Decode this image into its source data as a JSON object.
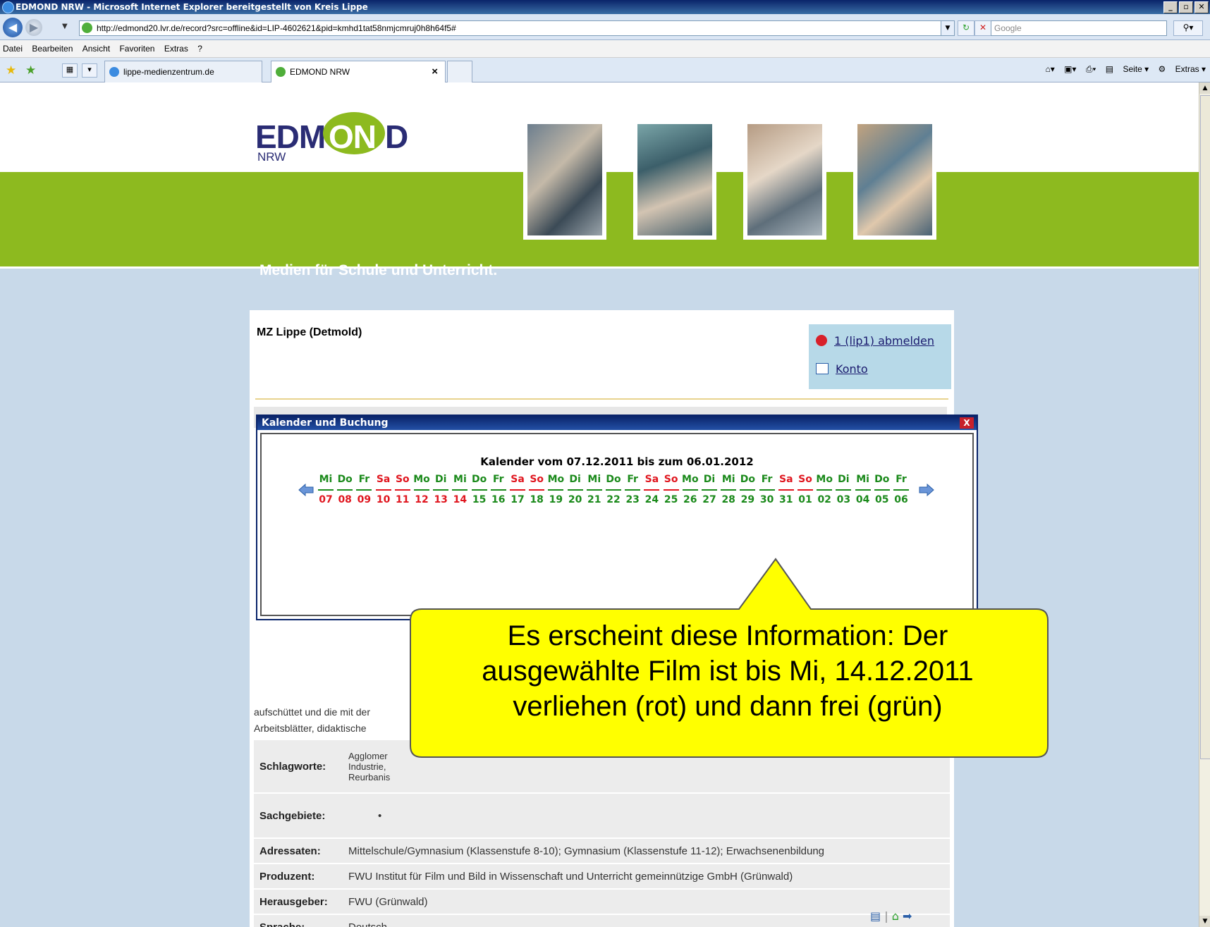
{
  "window": {
    "title": "EDMOND NRW - Microsoft Internet Explorer bereitgestellt von Kreis Lippe",
    "buttons": [
      "_",
      "̅",
      "X"
    ]
  },
  "addressbar": {
    "url": "http://edmond20.lvr.de/record?src=offline&id=LIP-4602621&pid=kmhd1tat58nmjcmruj0h8h64f5#",
    "search_placeholder": "Google"
  },
  "menu": [
    "Datei",
    "Bearbeiten",
    "Ansicht",
    "Favoriten",
    "Extras",
    "?"
  ],
  "tabs": [
    {
      "label": "lippe-medienzentrum.de",
      "active": false
    },
    {
      "label": "EDMOND NRW",
      "active": true
    }
  ],
  "commandbar": {
    "page": "Seite",
    "extras": "Extras"
  },
  "header": {
    "logo_left": "EDM",
    "logo_mid": "ON",
    "logo_right": "D",
    "logo_sub": "NRW",
    "slogan": "Medien für Schule und Unterricht."
  },
  "card": {
    "org": "MZ Lippe (Detmold)",
    "logout": "1 (lip1) abmelden",
    "account": "Konto"
  },
  "description": {
    "line1": "aufschüttet und die mit der",
    "line2": "Arbeitsblätter, didaktische"
  },
  "meta": {
    "rows": [
      {
        "key": "Schlagworte:",
        "value": "Agglomer\nIndustrie,\nReurbanis"
      },
      {
        "key": "Sachgebiete:",
        "value": "•"
      },
      {
        "key": "Adressaten:",
        "value": "Mittelschule/Gymnasium (Klassenstufe 8-10); Gymnasium (Klassenstufe 11-12); Erwachsenenbildung"
      },
      {
        "key": "Produzent:",
        "value": "FWU Institut für Film und Bild in Wissenschaft und Unterricht gemeinnützige GmbH (Grünwald)"
      },
      {
        "key": "Herausgeber:",
        "value": "FWU (Grünwald)"
      },
      {
        "key": "Sprache:",
        "value": "Deutsch"
      }
    ]
  },
  "dialog": {
    "title": "Kalender und Buchung",
    "close": "X",
    "heading": "Kalender vom 07.12.2011 bis zum 06.01.2012",
    "colors": {
      "booked": "#e0161f",
      "free": "#1b8a1b"
    },
    "days": [
      {
        "wd": "Mi",
        "d": "07",
        "wd_red": false,
        "booked": true
      },
      {
        "wd": "Do",
        "d": "08",
        "wd_red": false,
        "booked": true
      },
      {
        "wd": "Fr",
        "d": "09",
        "wd_red": false,
        "booked": true
      },
      {
        "wd": "Sa",
        "d": "10",
        "wd_red": true,
        "booked": true
      },
      {
        "wd": "So",
        "d": "11",
        "wd_red": true,
        "booked": true
      },
      {
        "wd": "Mo",
        "d": "12",
        "wd_red": false,
        "booked": true
      },
      {
        "wd": "Di",
        "d": "13",
        "wd_red": false,
        "booked": true
      },
      {
        "wd": "Mi",
        "d": "14",
        "wd_red": false,
        "booked": true
      },
      {
        "wd": "Do",
        "d": "15",
        "wd_red": false,
        "booked": false
      },
      {
        "wd": "Fr",
        "d": "16",
        "wd_red": false,
        "booked": false
      },
      {
        "wd": "Sa",
        "d": "17",
        "wd_red": true,
        "booked": false
      },
      {
        "wd": "So",
        "d": "18",
        "wd_red": true,
        "booked": false
      },
      {
        "wd": "Mo",
        "d": "19",
        "wd_red": false,
        "booked": false
      },
      {
        "wd": "Di",
        "d": "20",
        "wd_red": false,
        "booked": false
      },
      {
        "wd": "Mi",
        "d": "21",
        "wd_red": false,
        "booked": false
      },
      {
        "wd": "Do",
        "d": "22",
        "wd_red": false,
        "booked": false
      },
      {
        "wd": "Fr",
        "d": "23",
        "wd_red": false,
        "booked": false
      },
      {
        "wd": "Sa",
        "d": "24",
        "wd_red": true,
        "booked": false
      },
      {
        "wd": "So",
        "d": "25",
        "wd_red": true,
        "booked": false
      },
      {
        "wd": "Mo",
        "d": "26",
        "wd_red": false,
        "booked": false
      },
      {
        "wd": "Di",
        "d": "27",
        "wd_red": false,
        "booked": false
      },
      {
        "wd": "Mi",
        "d": "28",
        "wd_red": false,
        "booked": false
      },
      {
        "wd": "Do",
        "d": "29",
        "wd_red": false,
        "booked": false
      },
      {
        "wd": "Fr",
        "d": "30",
        "wd_red": false,
        "booked": false
      },
      {
        "wd": "Sa",
        "d": "31",
        "wd_red": true,
        "booked": false
      },
      {
        "wd": "So",
        "d": "01",
        "wd_red": true,
        "booked": false
      },
      {
        "wd": "Mo",
        "d": "02",
        "wd_red": false,
        "booked": false
      },
      {
        "wd": "Di",
        "d": "03",
        "wd_red": false,
        "booked": false
      },
      {
        "wd": "Mi",
        "d": "04",
        "wd_red": false,
        "booked": false
      },
      {
        "wd": "Do",
        "d": "05",
        "wd_red": false,
        "booked": false
      },
      {
        "wd": "Fr",
        "d": "06",
        "wd_red": false,
        "booked": false
      }
    ]
  },
  "callout": {
    "line1": "Es erscheint diese Information: Der",
    "line2": "ausgewählte Film ist bis Mi, 14.12.2011",
    "line3": "verliehen (rot) und dann frei (grün)"
  }
}
